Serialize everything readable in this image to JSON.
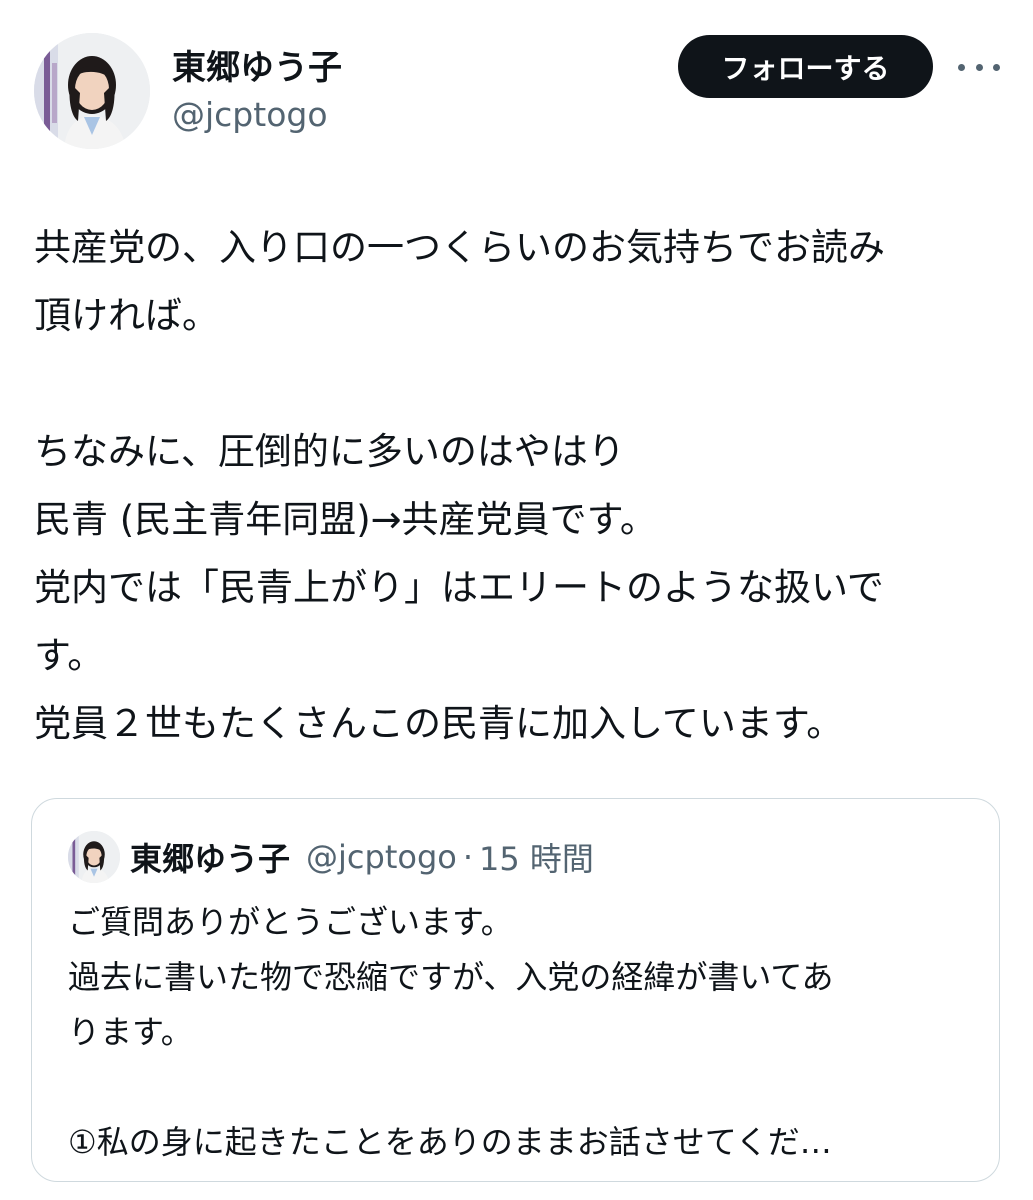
{
  "author": {
    "name": "東郷ゆう子",
    "handle": "@jcptogo"
  },
  "actions": {
    "follow_label": "フォローする"
  },
  "icons": {
    "more": "more-horizontal-icon"
  },
  "tweet": {
    "lines": [
      "共産党の、入り口の一つくらいのお気持ちでお読み",
      "頂ければ。",
      "",
      "ちなみに、圧倒的に多いのはやはり",
      "民青 (民主青年同盟)→共産党員です。",
      "党内では「民青上がり」はエリートのような扱いで",
      "す。",
      "党員２世もたくさんこの民青に加入しています。"
    ]
  },
  "quote": {
    "author_name": "東郷ゆう子",
    "handle": "@jcptogo",
    "separator": "·",
    "time": "15 時間",
    "lines": [
      "ご質問ありがとうございます。",
      "過去に書いた物で恐縮ですが、入党の経緯が書いてあ",
      "ります。",
      "",
      "①私の身に起きたことをありのままお話させてくだ…"
    ]
  },
  "colors": {
    "text_primary": "#0f1419",
    "text_secondary": "#536471",
    "follow_button_bg": "#0f1419",
    "follow_button_text": "#ffffff",
    "card_border": "#cfd9de"
  }
}
